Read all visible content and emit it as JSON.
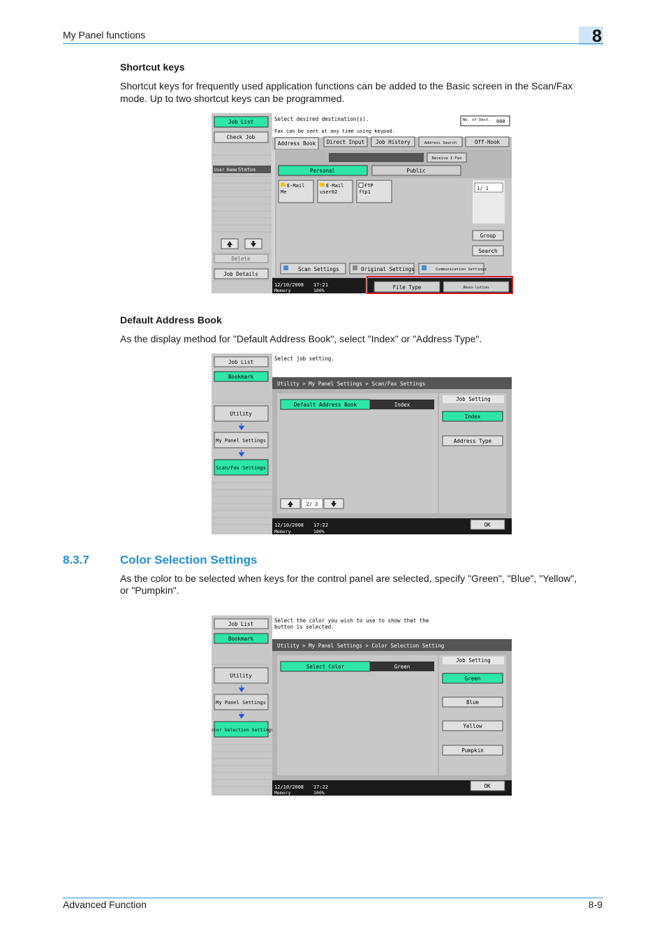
{
  "header": {
    "section_title": "My Panel functions",
    "chapter_number": "8"
  },
  "shortcut_keys": {
    "heading": "Shortcut keys",
    "para_line1": "Shortcut keys for frequently used application functions can be added to the Basic screen in the Scan/Fax",
    "para_line2": "mode. Up to two shortcut keys can be programmed."
  },
  "screen1": {
    "left_buttons": [
      "Job List",
      "Check Job"
    ],
    "user_name": "User Name",
    "status": "Status",
    "delete": "Delete",
    "job_details": "Job Details",
    "message": "Select desired destination(s).",
    "tip": "Fax can be sent at any time using keypad.",
    "no_of_dest": "No. of Dest.",
    "dest_count": "000",
    "tabs": [
      "Address Book",
      "Direct Input",
      "Job History",
      "Address Search",
      "Off-Hook"
    ],
    "receive_ifax": "Receive I-Fax",
    "personal": "Personal",
    "public": "Public",
    "destinations": [
      {
        "type": "E-Mail",
        "name": "Me"
      },
      {
        "type": "E-Mail",
        "name": "user02"
      },
      {
        "type": "FTP",
        "name": "ftp1"
      }
    ],
    "page_indicator": "1/   1",
    "group": "Group",
    "search": "Search",
    "bottom_buttons": [
      "Scan Settings",
      "Original Settings",
      "Communication Settings"
    ],
    "shortcut_buttons": [
      "File Type",
      "Reso-lution"
    ],
    "date": "12/10/2008",
    "time": "17:21",
    "memory": "Memory",
    "memory_pct": "100%"
  },
  "default_address_book": {
    "heading": "Default Address Book",
    "para": "As the display method for \"Default Address Book\", select \"Index\" or \"Address Type\"."
  },
  "screen2": {
    "left_buttons": [
      "Job List",
      "Bookmark"
    ],
    "nav": [
      "Utility",
      "My Panel Settings",
      "Scan/Fax Settings"
    ],
    "message": "Select job setting.",
    "breadcrumb": "Utility > My Panel Settings > Scan/Fax Settings",
    "setting_label": "Default Address Book",
    "setting_value": "Index",
    "job_setting_header": "Job Setting",
    "options": [
      "Index",
      "Address Type"
    ],
    "page": "2/ 2",
    "ok": "OK",
    "date": "12/10/2008",
    "time": "17:22",
    "memory": "Memory",
    "memory_pct": "100%"
  },
  "color_selection": {
    "number": "8.3.7",
    "title": "Color Selection Settings",
    "para_line1": "As the color to be selected when keys for the control panel are selected, specify \"Green\", \"Blue\", \"Yellow\",",
    "para_line2": "or \"Pumpkin\"."
  },
  "screen3": {
    "left_buttons": [
      "Job List",
      "Bookmark"
    ],
    "nav": [
      "Utility",
      "My Panel Settings",
      "Color Selection Settings"
    ],
    "message_line1": "Select the color you wish to use to show that the",
    "message_line2": "button is selected.",
    "breadcrumb": "Utility > My Panel Settings > Color Selection Setting",
    "setting_label": "Select Color",
    "setting_value": "Green",
    "job_setting_header": "Job Setting",
    "options": [
      "Green",
      "Blue",
      "Yellow",
      "Pumpkin"
    ],
    "ok": "OK",
    "date": "12/10/2008",
    "time": "17:22",
    "memory": "Memory",
    "memory_pct": "100%"
  },
  "footer": {
    "left": "Advanced Function",
    "right": "8-9"
  },
  "colors": {
    "accent": "#1e8fd8",
    "panel_green": "#2ee6a8",
    "highlight_red": "#d81c1c"
  }
}
